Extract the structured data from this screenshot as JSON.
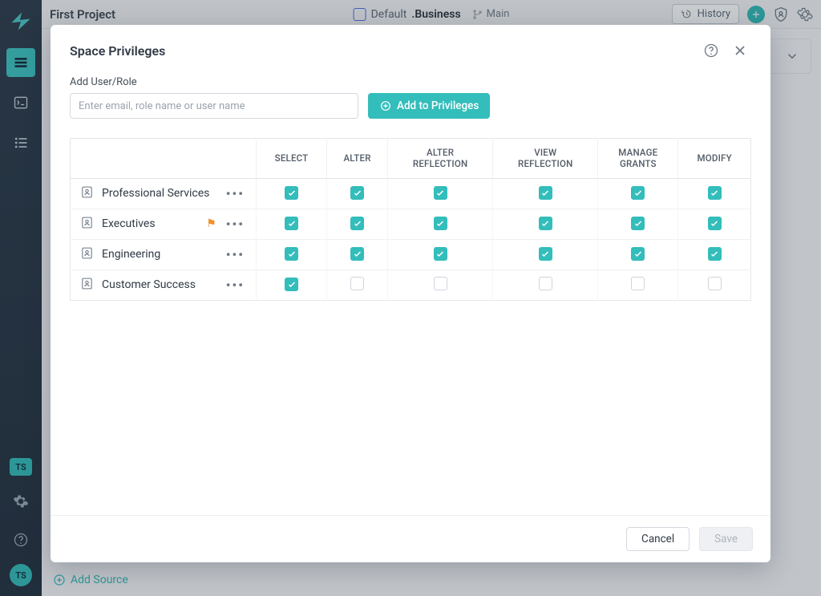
{
  "topbar": {
    "project": "First Project",
    "crumb_default": "Default",
    "crumb_current": ".Business",
    "branch": "Main",
    "history_label": "History"
  },
  "rail": {
    "chip": "TS",
    "avatar": "TS"
  },
  "bg": {
    "add_source": "Add Source"
  },
  "modal": {
    "title": "Space Privileges",
    "add_label": "Add User/Role",
    "placeholder": "Enter email, role name or user name",
    "add_button": "Add to Privileges",
    "cancel": "Cancel",
    "save": "Save"
  },
  "columns": [
    "SELECT",
    "ALTER",
    "ALTER REFLECTION",
    "VIEW REFLECTION",
    "MANAGE GRANTS",
    "MODIFY"
  ],
  "rows": [
    {
      "name": "Professional Services",
      "flag": false,
      "priv": [
        true,
        true,
        true,
        true,
        true,
        true
      ]
    },
    {
      "name": "Executives",
      "flag": true,
      "priv": [
        true,
        true,
        true,
        true,
        true,
        true
      ]
    },
    {
      "name": "Engineering",
      "flag": false,
      "priv": [
        true,
        true,
        true,
        true,
        true,
        true
      ]
    },
    {
      "name": "Customer Success",
      "flag": false,
      "priv": [
        true,
        false,
        false,
        false,
        false,
        false
      ]
    }
  ]
}
